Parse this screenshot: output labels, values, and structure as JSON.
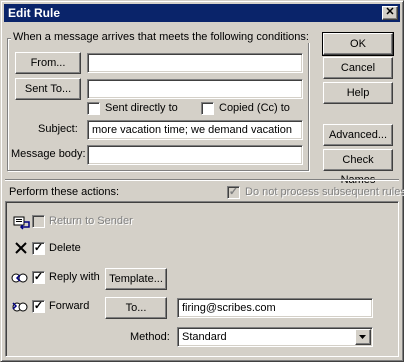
{
  "window": {
    "title": "Edit Rule",
    "close_glyph": "✕"
  },
  "conditions": {
    "group_label": "When a message arrives that meets the following conditions:",
    "from_button": "From...",
    "from_value": "",
    "sent_to_button": "Sent To...",
    "sent_to_value": "",
    "sent_directly_label": "Sent directly to",
    "sent_directly_checked": false,
    "copied_label": "Copied (Cc) to",
    "copied_checked": false,
    "subject_label": "Subject:",
    "subject_value": "more vacation time; we demand vacation",
    "body_label": "Message body:",
    "body_value": ""
  },
  "side_buttons": {
    "ok": "OK",
    "cancel": "Cancel",
    "help": "Help",
    "advanced": "Advanced...",
    "check_names": "Check Names"
  },
  "actions": {
    "label": "Perform these actions:",
    "do_not_process_label": "Do not process subsequent rules",
    "do_not_process_checked": true,
    "return_label": "Return to Sender",
    "return_checked": false,
    "delete_label": "Delete",
    "delete_checked": true,
    "reply_label": "Reply with",
    "reply_checked": true,
    "template_button": "Template...",
    "forward_label": "Forward",
    "forward_checked": true,
    "to_button": "To...",
    "forward_to_value": "firing@scribes.com",
    "method_label": "Method:",
    "method_value": "Standard"
  }
}
